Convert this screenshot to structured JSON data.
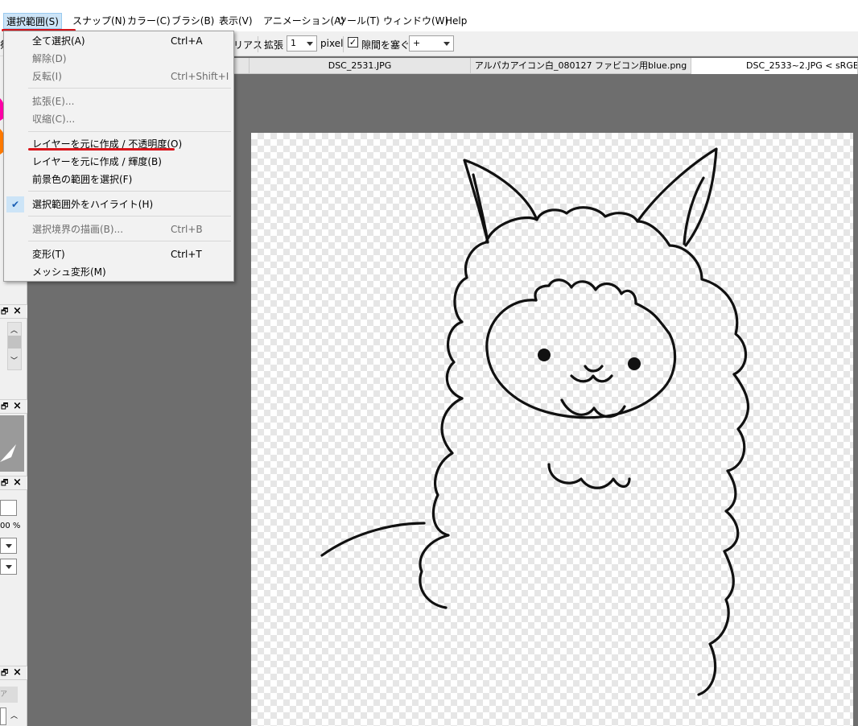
{
  "menubar": {
    "items": [
      "選択範囲(S)",
      "スナップ(N)",
      "カラー(C)",
      "ブラシ(B)",
      "表示(V)",
      "アニメーション(A)",
      "ツール(T)",
      "ウィンドウ(W)",
      "Help"
    ]
  },
  "toolbar": {
    "left_fragment": "祭",
    "aa_fragment": "リアス",
    "expand_label": "拡張",
    "expand_value": "1",
    "unit": "pixel",
    "gap_close_label": "隙間を塞ぐ",
    "gap_value": "+"
  },
  "tabs": [
    "DSC_2531.JPG",
    "アルパカアイコン白_080127 ファビコン用blue.png",
    "DSC_2533~2.JPG < sRGB >"
  ],
  "dropdown": {
    "items": [
      {
        "label": "全て選択(A)",
        "shortcut": "Ctrl+A",
        "disabled": false
      },
      {
        "label": "解除(D)",
        "shortcut": "",
        "disabled": true
      },
      {
        "label": "反転(I)",
        "shortcut": "Ctrl+Shift+I",
        "disabled": true
      },
      {
        "label": "拡張(E)...",
        "shortcut": "",
        "disabled": true
      },
      {
        "label": "収縮(C)...",
        "shortcut": "",
        "disabled": true
      },
      {
        "label": "レイヤーを元に作成 / 不透明度(O)",
        "shortcut": "",
        "disabled": false
      },
      {
        "label": "レイヤーを元に作成 / 輝度(B)",
        "shortcut": "",
        "disabled": false
      },
      {
        "label": "前景色の範囲を選択(F)",
        "shortcut": "",
        "disabled": false
      },
      {
        "label": "選択範囲外をハイライト(H)",
        "shortcut": "",
        "disabled": false,
        "checked": true
      },
      {
        "label": "選択境界の描画(B)...",
        "shortcut": "Ctrl+B",
        "disabled": true
      },
      {
        "label": "変形(T)",
        "shortcut": "Ctrl+T",
        "disabled": false
      },
      {
        "label": "メッシュ変形(M)",
        "shortcut": "",
        "disabled": false
      }
    ]
  },
  "left_panel": {
    "percent_fragment": "00 %",
    "tab_fragment": "ア"
  },
  "colors": {
    "accent_underline": "#d9151b",
    "menu_highlight": "#cce4f7",
    "workspace": "#6e6e6e"
  }
}
